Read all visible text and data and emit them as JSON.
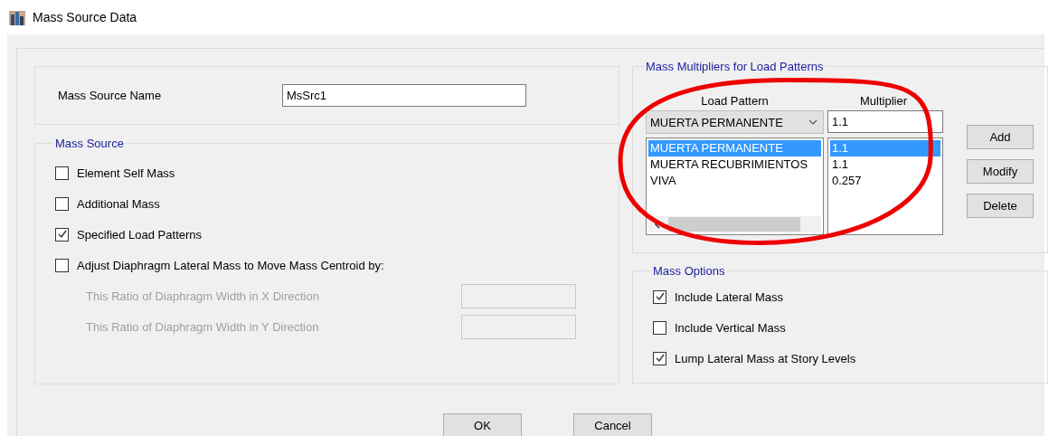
{
  "window": {
    "title": "Mass Source Data"
  },
  "mass_source_name": {
    "label": "Mass Source Name",
    "value": "MsSrc1"
  },
  "mass_source": {
    "title": "Mass Source",
    "options": [
      {
        "label": "Element Self Mass",
        "checked": false
      },
      {
        "label": "Additional Mass",
        "checked": false
      },
      {
        "label": "Specified Load Patterns",
        "checked": true
      },
      {
        "label": "Adjust Diaphragm Lateral Mass to Move Mass Centroid by:",
        "checked": false
      }
    ],
    "ratio_fields": [
      {
        "label": "This Ratio of Diaphragm Width in X Direction",
        "disabled": true
      },
      {
        "label": "This Ratio of Diaphragm Width in Y Direction",
        "disabled": true
      }
    ]
  },
  "multipliers": {
    "title": "Mass Multipliers for Load Patterns",
    "columns": [
      "Load Pattern",
      "Multiplier"
    ],
    "current": {
      "load_pattern": "MUERTA PERMANENTE",
      "multiplier": "1.1"
    },
    "rows": [
      {
        "load_pattern": "MUERTA PERMANENTE",
        "multiplier": "1.1",
        "selected": true
      },
      {
        "load_pattern": "MUERTA RECUBRIMIENTOS",
        "multiplier": "1.1",
        "selected": false
      },
      {
        "load_pattern": "VIVA",
        "multiplier": "0.257",
        "selected": false
      }
    ],
    "buttons": [
      "Add",
      "Modify",
      "Delete"
    ]
  },
  "mass_options": {
    "title": "Mass Options",
    "options": [
      {
        "label": "Include Lateral Mass",
        "checked": true
      },
      {
        "label": "Include Vertical Mass",
        "checked": false
      },
      {
        "label": "Lump Lateral Mass at Story Levels",
        "checked": true
      }
    ]
  },
  "buttons": [
    "OK",
    "Cancel"
  ]
}
